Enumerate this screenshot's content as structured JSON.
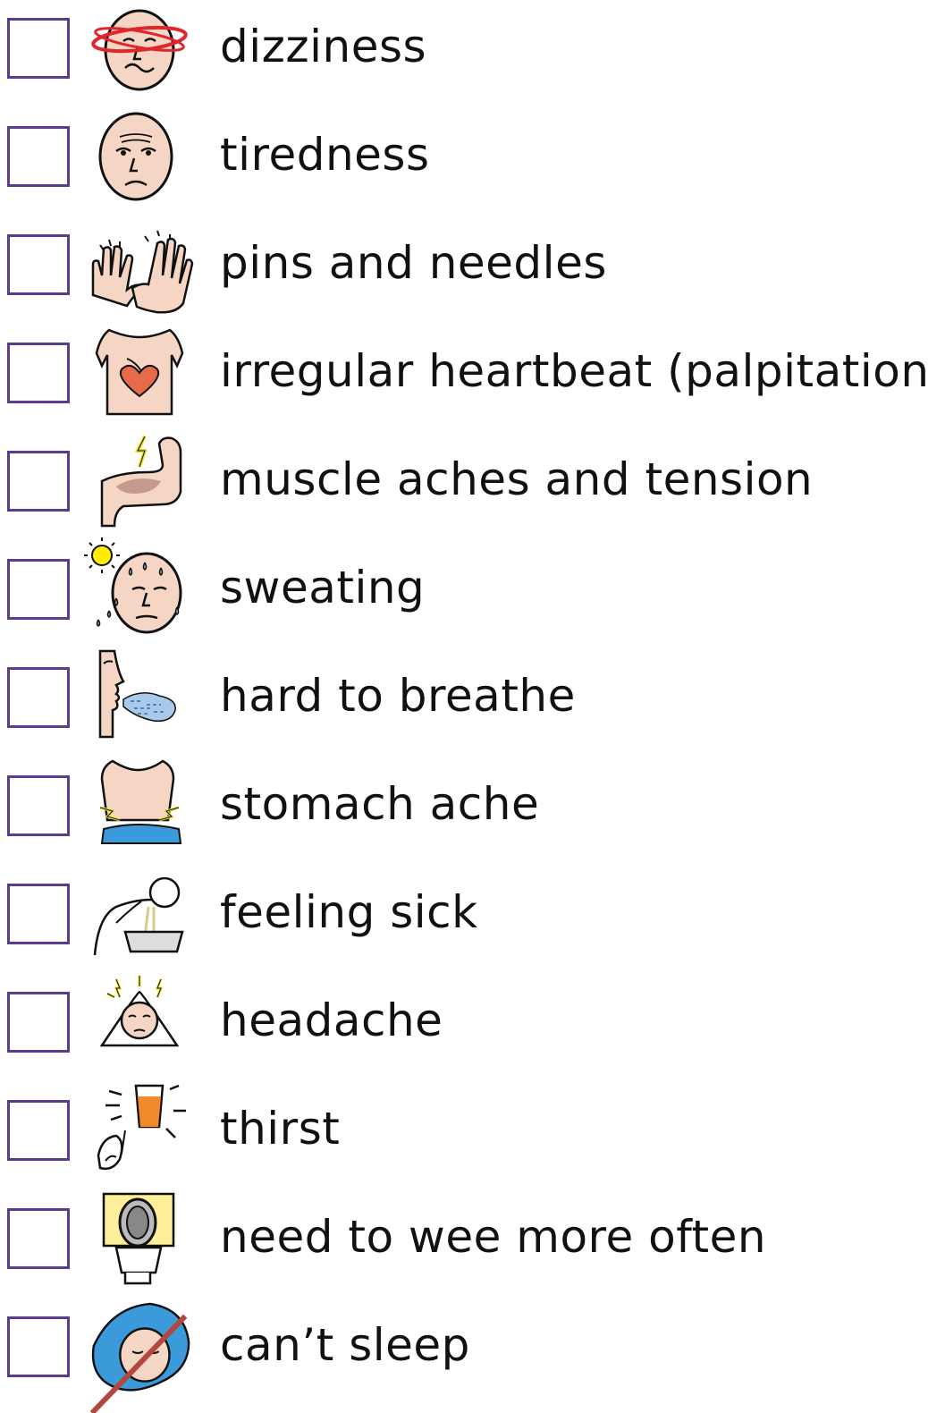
{
  "symptoms": [
    {
      "label": "dizziness",
      "icon": "dizzy-face-icon"
    },
    {
      "label": "tiredness",
      "icon": "tired-face-icon"
    },
    {
      "label": "pins and needles",
      "icon": "tingling-hands-icon"
    },
    {
      "label": "irregular heartbeat (palpitations)",
      "icon": "heart-chest-icon"
    },
    {
      "label": "muscle aches and tension",
      "icon": "flexed-arm-icon"
    },
    {
      "label": "sweating",
      "icon": "sweating-face-icon"
    },
    {
      "label": "hard to breathe",
      "icon": "breath-icon"
    },
    {
      "label": "stomach ache",
      "icon": "stomach-pain-icon"
    },
    {
      "label": "feeling sick",
      "icon": "vomiting-icon"
    },
    {
      "label": "headache",
      "icon": "headache-icon"
    },
    {
      "label": "thirst",
      "icon": "drink-glass-icon"
    },
    {
      "label": "need to wee more often",
      "icon": "toilet-icon"
    },
    {
      "label": "can’t sleep",
      "icon": "no-sleep-icon"
    }
  ],
  "colors": {
    "checkbox_border": "#5b3c8c",
    "skin": "#f5d6c4",
    "outline": "#111111",
    "dizzy_ring": "#e0262b",
    "sweat_drop": "#8fb4e0",
    "sun": "#ffee00",
    "breath": "#a9c9ea",
    "heart": "#e76a4a",
    "lightning": "#e8e02a",
    "drink": "#f08a2a",
    "toilet_bg": "#ffef9a",
    "pillow": "#3b9ad9",
    "strike": "#b4463d"
  }
}
